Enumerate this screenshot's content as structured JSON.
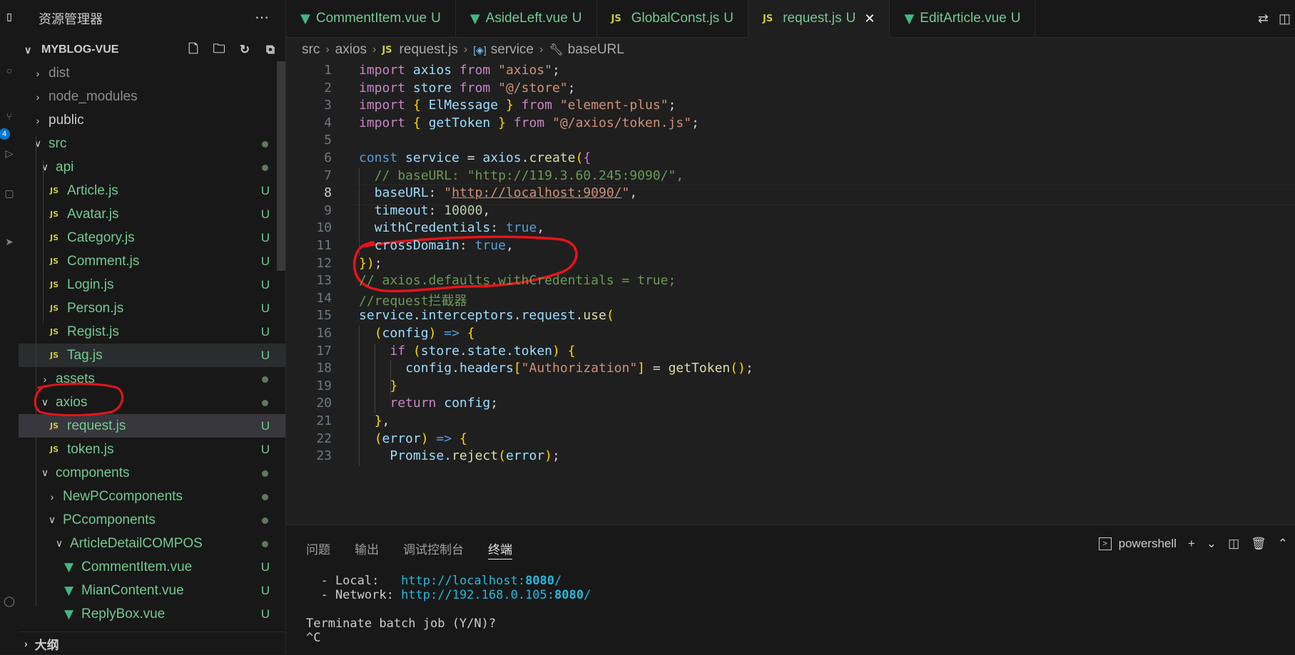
{
  "activity": {
    "badge": "4"
  },
  "explorer": {
    "title": "资源管理器",
    "project": "MYBLOG-VUE",
    "tree": [
      {
        "label": "dist",
        "depth": 0,
        "kind": "folder",
        "open": false,
        "tone": "gray"
      },
      {
        "label": "node_modules",
        "depth": 0,
        "kind": "folder",
        "open": false,
        "tone": "gray"
      },
      {
        "label": "public",
        "depth": 0,
        "kind": "folder",
        "open": false,
        "tone": "plain"
      },
      {
        "label": "src",
        "depth": 0,
        "kind": "folder",
        "open": true,
        "tone": "green",
        "status": "dot"
      },
      {
        "label": "api",
        "depth": 1,
        "kind": "folder",
        "open": true,
        "tone": "green",
        "status": "dot"
      },
      {
        "label": "Article.js",
        "depth": 1,
        "kind": "js",
        "tone": "green",
        "status": "U"
      },
      {
        "label": "Avatar.js",
        "depth": 1,
        "kind": "js",
        "tone": "green",
        "status": "U"
      },
      {
        "label": "Category.js",
        "depth": 1,
        "kind": "js",
        "tone": "green",
        "status": "U"
      },
      {
        "label": "Comment.js",
        "depth": 1,
        "kind": "js",
        "tone": "green",
        "status": "U"
      },
      {
        "label": "Login.js",
        "depth": 1,
        "kind": "js",
        "tone": "green",
        "status": "U"
      },
      {
        "label": "Person.js",
        "depth": 1,
        "kind": "js",
        "tone": "green",
        "status": "U"
      },
      {
        "label": "Regist.js",
        "depth": 1,
        "kind": "js",
        "tone": "green",
        "status": "U"
      },
      {
        "label": "Tag.js",
        "depth": 1,
        "kind": "js",
        "tone": "green",
        "status": "U",
        "state": "hover"
      },
      {
        "label": "assets",
        "depth": 1,
        "kind": "folder",
        "open": false,
        "tone": "green",
        "status": "dot"
      },
      {
        "label": "axios",
        "depth": 1,
        "kind": "folder",
        "open": true,
        "tone": "green",
        "status": "dot"
      },
      {
        "label": "request.js",
        "depth": 1,
        "kind": "js",
        "tone": "green",
        "status": "U",
        "state": "selected"
      },
      {
        "label": "token.js",
        "depth": 1,
        "kind": "js",
        "tone": "green",
        "status": "U"
      },
      {
        "label": "components",
        "depth": 1,
        "kind": "folder",
        "open": true,
        "tone": "green",
        "status": "dot"
      },
      {
        "label": "NewPCcomponents",
        "depth": 2,
        "kind": "folder",
        "open": false,
        "tone": "green",
        "status": "dot"
      },
      {
        "label": "PCcomponents",
        "depth": 2,
        "kind": "folder",
        "open": true,
        "tone": "green",
        "status": "dot"
      },
      {
        "label": "ArticleDetailCOMPOS",
        "depth": 3,
        "kind": "folder",
        "open": true,
        "tone": "green",
        "status": "dot"
      },
      {
        "label": "CommentItem.vue",
        "depth": 3,
        "kind": "vue",
        "tone": "green",
        "status": "U"
      },
      {
        "label": "MianContent.vue",
        "depth": 3,
        "kind": "vue",
        "tone": "green",
        "status": "U"
      },
      {
        "label": "ReplyBox.vue",
        "depth": 3,
        "kind": "vue",
        "tone": "green",
        "status": "U"
      }
    ],
    "outline_label": "大纲"
  },
  "tabs": [
    {
      "label": "CommentItem.vue",
      "mark": "U",
      "kind": "vue",
      "active": false
    },
    {
      "label": "AsideLeft.vue",
      "mark": "U",
      "kind": "vue",
      "active": false
    },
    {
      "label": "GlobalConst.js",
      "mark": "U",
      "kind": "js",
      "active": false
    },
    {
      "label": "request.js",
      "mark": "U",
      "kind": "js",
      "active": true
    },
    {
      "label": "EditArticle.vue",
      "mark": "U",
      "kind": "vue",
      "active": false
    }
  ],
  "breadcrumb": {
    "c1": "src",
    "c2": "axios",
    "c3": "request.js",
    "c4": "service",
    "c5": "baseURL"
  },
  "editor": {
    "current_line": 8,
    "lines": [
      "import axios from \"axios\";",
      "import store from \"@/store\";",
      "import { ElMessage } from \"element-plus\";",
      "import { getToken } from \"@/axios/token.js\";",
      "",
      "const service = axios.create({",
      "  // baseURL: \"http://119.3.60.245:9090/\",",
      "  baseURL: \"http://localhost:9090/\",",
      "  timeout: 10000,",
      "  withCredentials: true,",
      "  crossDomain: true,",
      "});",
      "// axios.defaults.withCredentials = true;",
      "//request拦截器",
      "service.interceptors.request.use(",
      "  (config) => {",
      "    if (store.state.token) {",
      "      config.headers[\"Authorization\"] = getToken();",
      "    }",
      "    return config;",
      "  },",
      "  (error) => {",
      "    Promise.reject(error);"
    ]
  },
  "panel": {
    "tabs": [
      "问题",
      "输出",
      "调试控制台",
      "终端"
    ],
    "active_tab": "终端",
    "shell": "powershell",
    "terminal": {
      "local_label": "  - Local:   ",
      "local_url_pre": "http://localhost:",
      "local_url_port": "8080",
      "local_url_post": "/",
      "network_label": "  - Network: ",
      "network_url_pre": "http://192.168.0.105:",
      "network_url_port": "8080",
      "network_url_post": "/",
      "prompt": "Terminate batch job (Y/N)?",
      "ctrl_c": "^C"
    }
  },
  "annotation_color": "#e8131a"
}
